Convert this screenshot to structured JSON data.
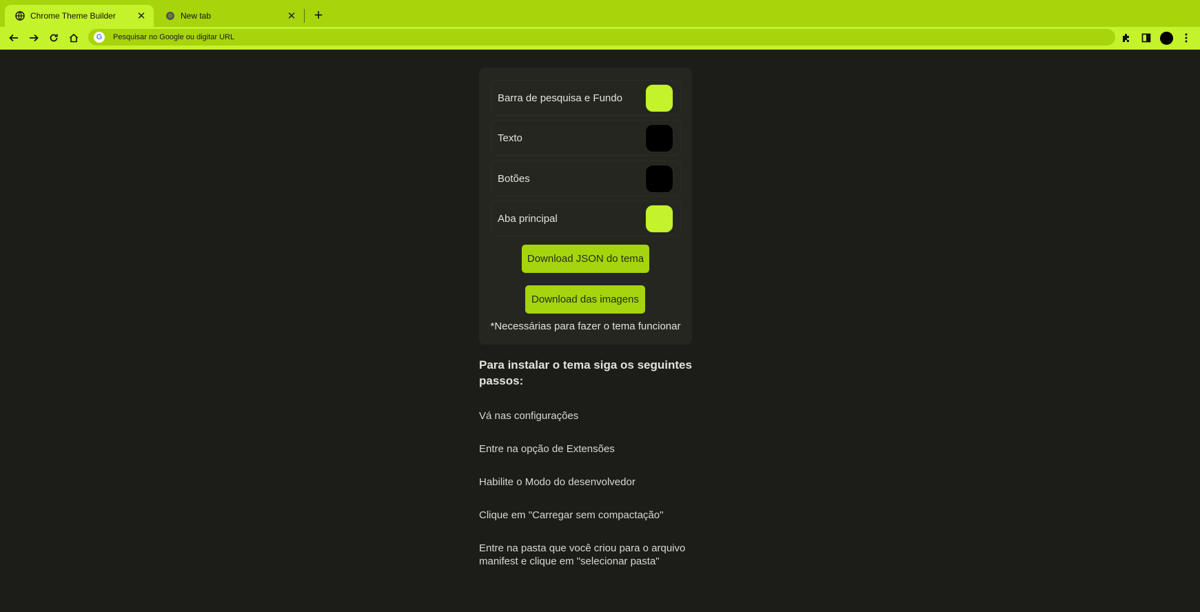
{
  "browser": {
    "tabs": [
      {
        "title": "Chrome Theme Builder",
        "active": true,
        "icon": "globe-icon"
      },
      {
        "title": "New tab",
        "active": false,
        "icon": "chrome-icon"
      }
    ],
    "omnibox_placeholder": "Pesquisar no Google ou digitar URL",
    "colors": {
      "frame": "#a8d40c",
      "toolbar": "#c4f22b"
    }
  },
  "theme_builder": {
    "color_rows": [
      {
        "label": "Barra de pesquisa e Fundo",
        "color": "#c4f22b"
      },
      {
        "label": "Texto",
        "color": "#000000"
      },
      {
        "label": "Botões",
        "color": "#000000"
      },
      {
        "label": "Aba principal",
        "color": "#c4f22b"
      }
    ],
    "download_json_label": "Download JSON do tema",
    "download_images_label": "Download das imagens",
    "note": "*Necessárias para fazer o tema funcionar"
  },
  "instructions": {
    "title": "Para instalar o tema siga os seguintes passos:",
    "steps": [
      "Vá nas configurações",
      "Entre na opção de Extensões",
      "Habilite o Modo do desenvolvedor",
      "Clique em \"Carregar sem compactação\"",
      "Entre na pasta que você criou para o arquivo manifest e clique em \"selecionar pasta\""
    ]
  }
}
